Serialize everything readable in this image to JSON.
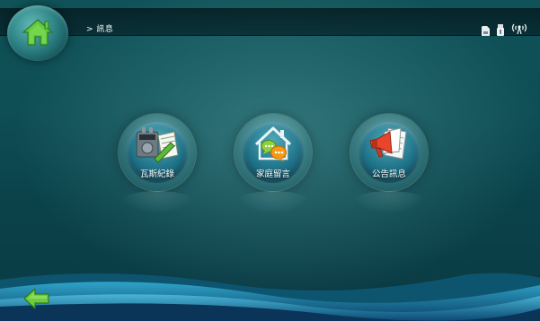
{
  "header": {
    "breadcrumb": "> 訊息",
    "home_icon": "home-icon",
    "status_icons": [
      "sd-card-icon",
      "usb-icon",
      "wireless-signal-icon"
    ]
  },
  "tiles": [
    {
      "label": "瓦斯紀錄",
      "icon": "gas-meter-icon"
    },
    {
      "label": "家庭留言",
      "icon": "family-message-icon"
    },
    {
      "label": "公告訊息",
      "icon": "announcement-icon"
    }
  ],
  "footer": {
    "back_icon": "back-arrow-icon"
  },
  "colors": {
    "background": "#0e4e55",
    "home_arrow_green": "#5bc53a",
    "bubble_orange": "#f59a12",
    "megaphone_red": "#e8452c"
  }
}
